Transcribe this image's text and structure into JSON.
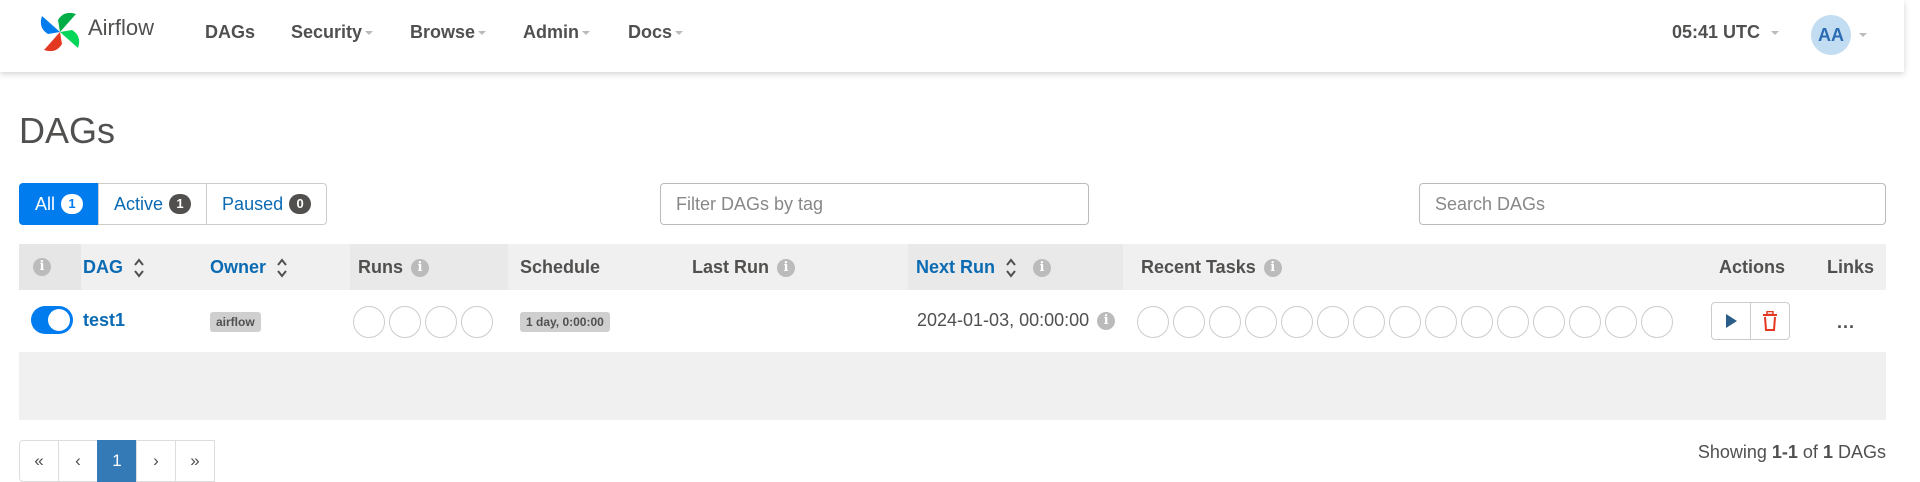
{
  "navbar": {
    "brand": "Airflow",
    "items": [
      {
        "label": "DAGs",
        "dropdown": false
      },
      {
        "label": "Security",
        "dropdown": true
      },
      {
        "label": "Browse",
        "dropdown": true
      },
      {
        "label": "Admin",
        "dropdown": true
      },
      {
        "label": "Docs",
        "dropdown": true
      }
    ],
    "clock": "05:41 UTC",
    "avatar": "AA"
  },
  "page": {
    "title": "DAGs"
  },
  "filters": {
    "all": {
      "label": "All",
      "count": "1"
    },
    "active": {
      "label": "Active",
      "count": "1"
    },
    "paused": {
      "label": "Paused",
      "count": "0"
    },
    "tag_placeholder": "Filter DAGs by tag",
    "search_placeholder": "Search DAGs"
  },
  "table": {
    "headers": {
      "dag": "DAG",
      "owner": "Owner",
      "runs": "Runs",
      "schedule": "Schedule",
      "last_run": "Last Run",
      "next_run": "Next Run",
      "recent_tasks": "Recent Tasks",
      "actions": "Actions",
      "links": "Links"
    },
    "rows": [
      {
        "enabled": true,
        "dag_id": "test1",
        "owner": "airflow",
        "runs_circles": 4,
        "schedule": "1 day, 0:00:00",
        "last_run": "",
        "next_run": "2024-01-03, 00:00:00",
        "recent_task_circles": 15,
        "links": "..."
      }
    ]
  },
  "pagination": {
    "first": "«",
    "prev": "‹",
    "current": "1",
    "next": "›",
    "last": "»"
  },
  "footer": {
    "showing_prefix": "Showing",
    "range": "1-1",
    "of": "of",
    "total": "1",
    "suffix": "DAGs"
  },
  "colors": {
    "primary": "#017cee",
    "link": "#0a6ab3",
    "delete": "#e43921",
    "text": "#51504f"
  }
}
